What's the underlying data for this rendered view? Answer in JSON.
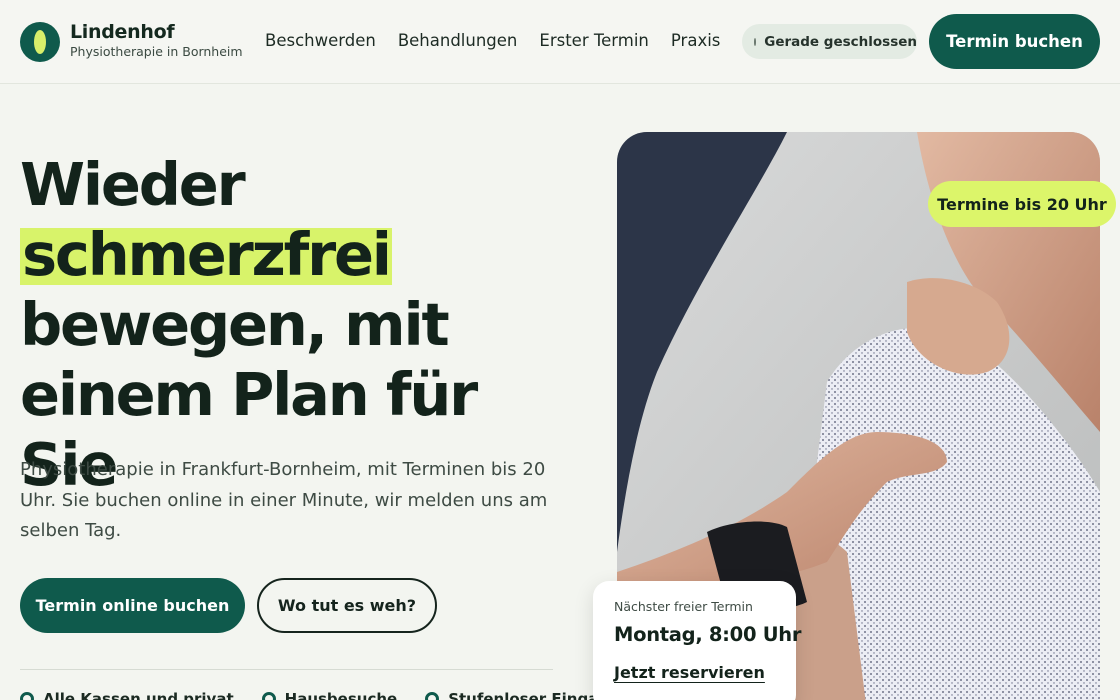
{
  "brand": {
    "name": "Lindenhof",
    "tagline": "Physiotherapie in Bornheim"
  },
  "nav": {
    "items": [
      {
        "label": "Beschwerden"
      },
      {
        "label": "Behandlungen"
      },
      {
        "label": "Erster Termin"
      },
      {
        "label": "Praxis"
      }
    ]
  },
  "status": {
    "label": "Gerade geschlossen"
  },
  "header_cta": {
    "label": "Termin buchen"
  },
  "hero": {
    "title_line1": "Wieder",
    "title_highlight": "schmerzfrei",
    "title_line3": "bewegen, mit",
    "title_line4": "einem Plan für Sie",
    "body": "Physiotherapie in Frankfurt-Bornheim, mit Terminen bis 20 Uhr. Sie buchen online in einer Minute, wir melden uns am selben Tag.",
    "primary_button": "Termin online buchen",
    "secondary_button": "Wo tut es weh?"
  },
  "features": [
    {
      "label": "Alle Kassen und privat"
    },
    {
      "label": "Hausbesuche"
    },
    {
      "label": "Stufenloser Eingang"
    }
  ],
  "photo": {
    "badge": "Termine bis 20 Uhr"
  },
  "slot_card": {
    "label": "Nächster freier Termin",
    "value": "Montag, 8:00 Uhr",
    "link": "Jetzt reservieren"
  },
  "colors": {
    "brand_green": "#0f5a4c",
    "accent_lime": "#d8f36a",
    "background": "#f3f5f0"
  }
}
